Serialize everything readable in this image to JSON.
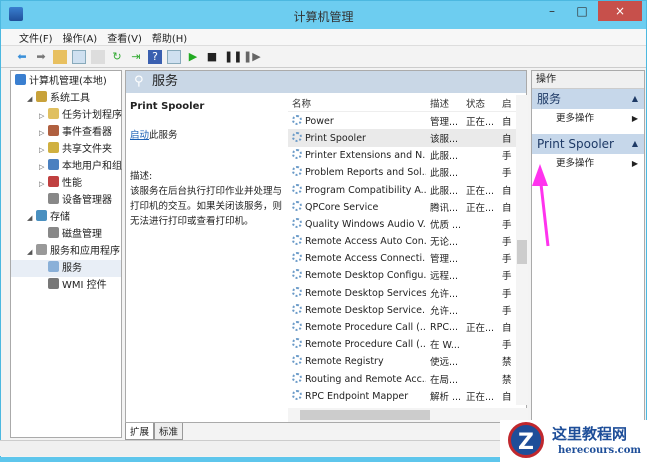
{
  "window": {
    "title": "计算机管理",
    "minimize": "–",
    "maximize": "□",
    "close": "×"
  },
  "menu": [
    "文件(F)",
    "操作(A)",
    "查看(V)",
    "帮助(H)"
  ],
  "tree": [
    {
      "label": "计算机管理(本地)",
      "indent": 0,
      "color": "#3a7fd0"
    },
    {
      "label": "系统工具",
      "indent": 1,
      "color": "#c8a23a"
    },
    {
      "label": "任务计划程序",
      "indent": 2,
      "color": "#e0c060"
    },
    {
      "label": "事件查看器",
      "indent": 2,
      "color": "#b06040"
    },
    {
      "label": "共享文件夹",
      "indent": 2,
      "color": "#d0b040"
    },
    {
      "label": "本地用户和组",
      "indent": 2,
      "color": "#4a80c0"
    },
    {
      "label": "性能",
      "indent": 2,
      "color": "#c04040"
    },
    {
      "label": "设备管理器",
      "indent": 2,
      "color": "#888"
    },
    {
      "label": "存储",
      "indent": 1,
      "color": "#4a90c0"
    },
    {
      "label": "磁盘管理",
      "indent": 2,
      "color": "#888"
    },
    {
      "label": "服务和应用程序",
      "indent": 1,
      "color": "#999"
    },
    {
      "label": "服务",
      "indent": 2,
      "color": "#8ab0d8"
    },
    {
      "label": "WMI 控件",
      "indent": 2,
      "color": "#777"
    }
  ],
  "middle": {
    "header": "服务",
    "service_name": "Print Spooler",
    "start_link": "启动",
    "start_suffix": "此服务",
    "desc_label": "描述:",
    "description": "该服务在后台执行打印作业并处理与打印机的交互。如果关闭该服务，则无法进行打印或查看打印机。"
  },
  "list": {
    "columns": [
      "名称",
      "描述",
      "状态",
      "启"
    ],
    "rows": [
      [
        "Power",
        "管理...",
        "正在...",
        "自"
      ],
      [
        "Print Spooler",
        "该服...",
        "",
        "自"
      ],
      [
        "Printer Extensions and N...",
        "此服...",
        "",
        "手"
      ],
      [
        "Problem Reports and Sol...",
        "此服...",
        "",
        "手"
      ],
      [
        "Program Compatibility A...",
        "此服...",
        "正在...",
        "自"
      ],
      [
        "QPCore Service",
        "腾讯...",
        "正在...",
        "自"
      ],
      [
        "Quality Windows Audio V...",
        "优质 ...",
        "",
        "手"
      ],
      [
        "Remote Access Auto Con...",
        "无论...",
        "",
        "手"
      ],
      [
        "Remote Access Connecti...",
        "管理...",
        "",
        "手"
      ],
      [
        "Remote Desktop Configu...",
        "远程...",
        "",
        "手"
      ],
      [
        "Remote Desktop Services",
        "允许...",
        "",
        "手"
      ],
      [
        "Remote Desktop Service...",
        "允许...",
        "",
        "手"
      ],
      [
        "Remote Procedure Call (...",
        "RPC...",
        "正在...",
        "自"
      ],
      [
        "Remote Procedure Call (...",
        "在 W...",
        "",
        "手"
      ],
      [
        "Remote Registry",
        "使远...",
        "",
        "禁"
      ],
      [
        "Routing and Remote Acc...",
        "在局...",
        "",
        "禁"
      ],
      [
        "RPC Endpoint Mapper",
        "解析 ...",
        "正在...",
        "自"
      ]
    ]
  },
  "tabs": [
    "扩展",
    "标准"
  ],
  "actions": {
    "header": "操作",
    "groups": [
      {
        "title": "服务",
        "item": "更多操作"
      },
      {
        "title": "Print Spooler",
        "item": "更多操作"
      }
    ]
  },
  "watermark": {
    "name": "这里教程网",
    "url": "herecours.com"
  },
  "colors": {
    "accent": "#6dcdf0",
    "arrow": "#ff33ee"
  }
}
